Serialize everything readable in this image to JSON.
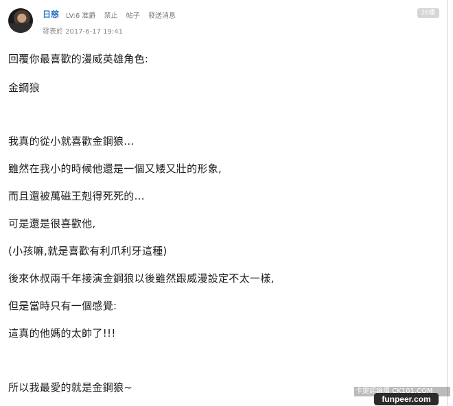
{
  "header": {
    "username": "日慈",
    "level": "LV:6 准爵",
    "actions": [
      "禁止",
      "帖子",
      "發送消息"
    ],
    "post_time": "發表於 2017-6-17 19:41",
    "floor": "26樓"
  },
  "post": {
    "lines": [
      "回覆你最喜歡的漫威英雄角色:",
      "金鋼狼",
      "我真的從小就喜歡金鋼狼...",
      "雖然在我小的時候他還是一個又矮又壯的形象,",
      "而且還被萬磁王剋得死死的...",
      "可是還是很喜歡他,",
      "(小孩嘛,就是喜歡有利爪利牙這種)",
      "後來休叔兩千年接演金鋼狼以後雖然跟威漫設定不太一樣,",
      "但是當時只有一個感覺:",
      "這真的他媽的太帥了!!!",
      "所以我最愛的就是金鋼狼~"
    ]
  },
  "watermarks": {
    "strip_text": "卡提諾論壇 CK101.COM",
    "logo_text": "funpeer.com"
  }
}
